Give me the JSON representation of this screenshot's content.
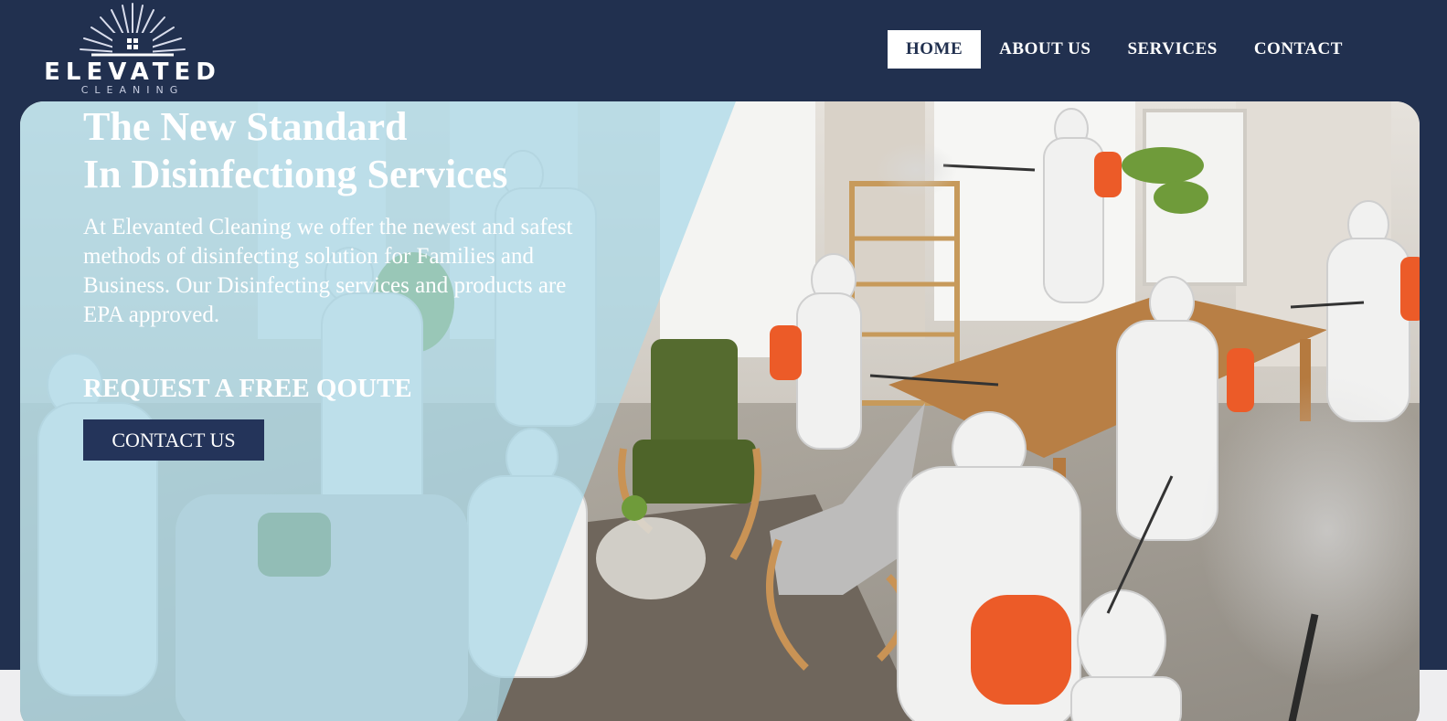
{
  "logo": {
    "word": "ELEVATED",
    "sub": "CLEANING",
    "icon": "sunburst-house-icon"
  },
  "nav": {
    "items": [
      {
        "label": "HOME",
        "active": true
      },
      {
        "label": "ABOUT US",
        "active": false
      },
      {
        "label": "SERVICES",
        "active": false
      },
      {
        "label": "CONTACT",
        "active": false
      }
    ]
  },
  "hero": {
    "title_line1": "The New Standard",
    "title_line2": "In Disinfectiong Services",
    "description": "At Elevanted Cleaning we offer the newest and safest methods of disinfecting solution for Families and Business. Our Disinfecting services and products are EPA approved.",
    "cta_heading": "REQUEST A FREE QOUTE",
    "cta_button": "CONTACT US",
    "image": "workers-in-protective-suits-disinfecting-room"
  },
  "colors": {
    "navy": "#21304f",
    "overlay": "#a9d8e8",
    "button": "#24345a",
    "white": "#ffffff"
  }
}
